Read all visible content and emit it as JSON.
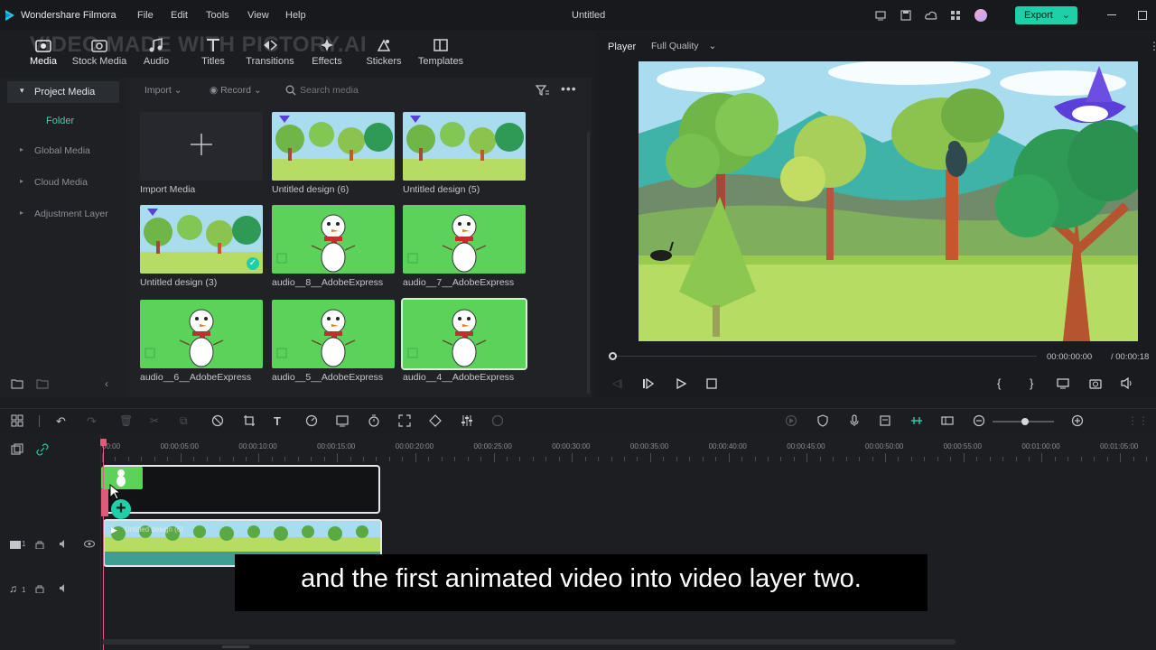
{
  "app": {
    "name": "Wondershare Filmora",
    "document_title": "Untitled",
    "export_label": "Export"
  },
  "menu": [
    "File",
    "Edit",
    "Tools",
    "View",
    "Help"
  ],
  "toolbar": [
    "Media",
    "Stock Media",
    "Audio",
    "Titles",
    "Transitions",
    "Effects",
    "Stickers",
    "Templates"
  ],
  "watermark": "VIDEO MADE WITH PICTORY.AI",
  "left_panel": {
    "project_media": "Project Media",
    "folder": "Folder",
    "items": [
      "Global Media",
      "Cloud Media",
      "Adjustment Layer"
    ]
  },
  "media_toolbar": {
    "import": "Import",
    "record": "Record",
    "search_placeholder": "Search media"
  },
  "media": [
    {
      "label": "Import Media",
      "kind": "import"
    },
    {
      "label": "Untitled design (6)",
      "kind": "forest"
    },
    {
      "label": "Untitled design (5)",
      "kind": "forest"
    },
    {
      "label": "Untitled design (3)",
      "kind": "forest"
    },
    {
      "label": "audio__8__AdobeExpress",
      "kind": "snowman"
    },
    {
      "label": "audio__7__AdobeExpress",
      "kind": "snowman"
    },
    {
      "label": "audio__6__AdobeExpress",
      "kind": "snowman"
    },
    {
      "label": "audio__5__AdobeExpress",
      "kind": "snowman"
    },
    {
      "label": "audio__4__AdobeExpress",
      "kind": "snowman"
    }
  ],
  "player": {
    "tab": "Player",
    "quality": "Full Quality",
    "current_time": "00:00:00:00",
    "total_time": "/ 00:00:18"
  },
  "ruler": [
    "00:00",
    "00:00:05:00",
    "00:00:10:00",
    "00:00:15:00",
    "00:00:20:00",
    "00:00:25:00",
    "00:00:30:00",
    "00:00:35:00",
    "00:00:40:00",
    "00:00:45:00",
    "00:00:50:00",
    "00:00:55:00",
    "00:01:00:00",
    "00:01:05:00"
  ],
  "tracks": {
    "video1_num": "1",
    "audio1_num": "1",
    "clip_label": "Untitled design (6)"
  },
  "subtitle": "and the first animated video into video layer two.",
  "colors": {
    "accent": "#1ed0a8",
    "green_screen": "#5bd35b",
    "sky": "#a7dcef",
    "grass": "#b6dc63"
  }
}
